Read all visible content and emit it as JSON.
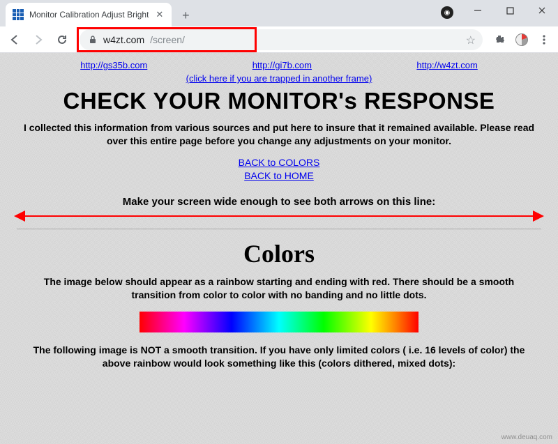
{
  "tab": {
    "title": "Monitor Calibration Adjust Bright"
  },
  "url": {
    "host": "w4zt.com",
    "path": "/screen/"
  },
  "topLinks": {
    "a": "http://gs35b.com",
    "b": "http://gi7b.com",
    "c": "http://w4zt.com"
  },
  "frameLink": "(click here if you are trapped in another frame)",
  "heading": "CHECK YOUR MONITOR's RESPONSE",
  "intro": "I collected this information from various sources and put here to insure that it remained available. Please read over this entire page before you change any adjustments on your monitor.",
  "back": {
    "colors": "BACK to COLORS",
    "home": "BACK to HOME"
  },
  "widen": "Make your screen wide enough to see both arrows on this line:",
  "colorsHeading": "Colors",
  "rainbowText": "The image below should appear as a rainbow starting and ending with red. There should be a smooth transition from color to color with no banding and no little dots.",
  "ditheredText": "The following image is NOT a smooth transition. If you have only limited colors ( i.e. 16 levels of color) the above rainbow would look something like this (colors dithered, mixed dots):",
  "watermark": "www.deuaq.com"
}
